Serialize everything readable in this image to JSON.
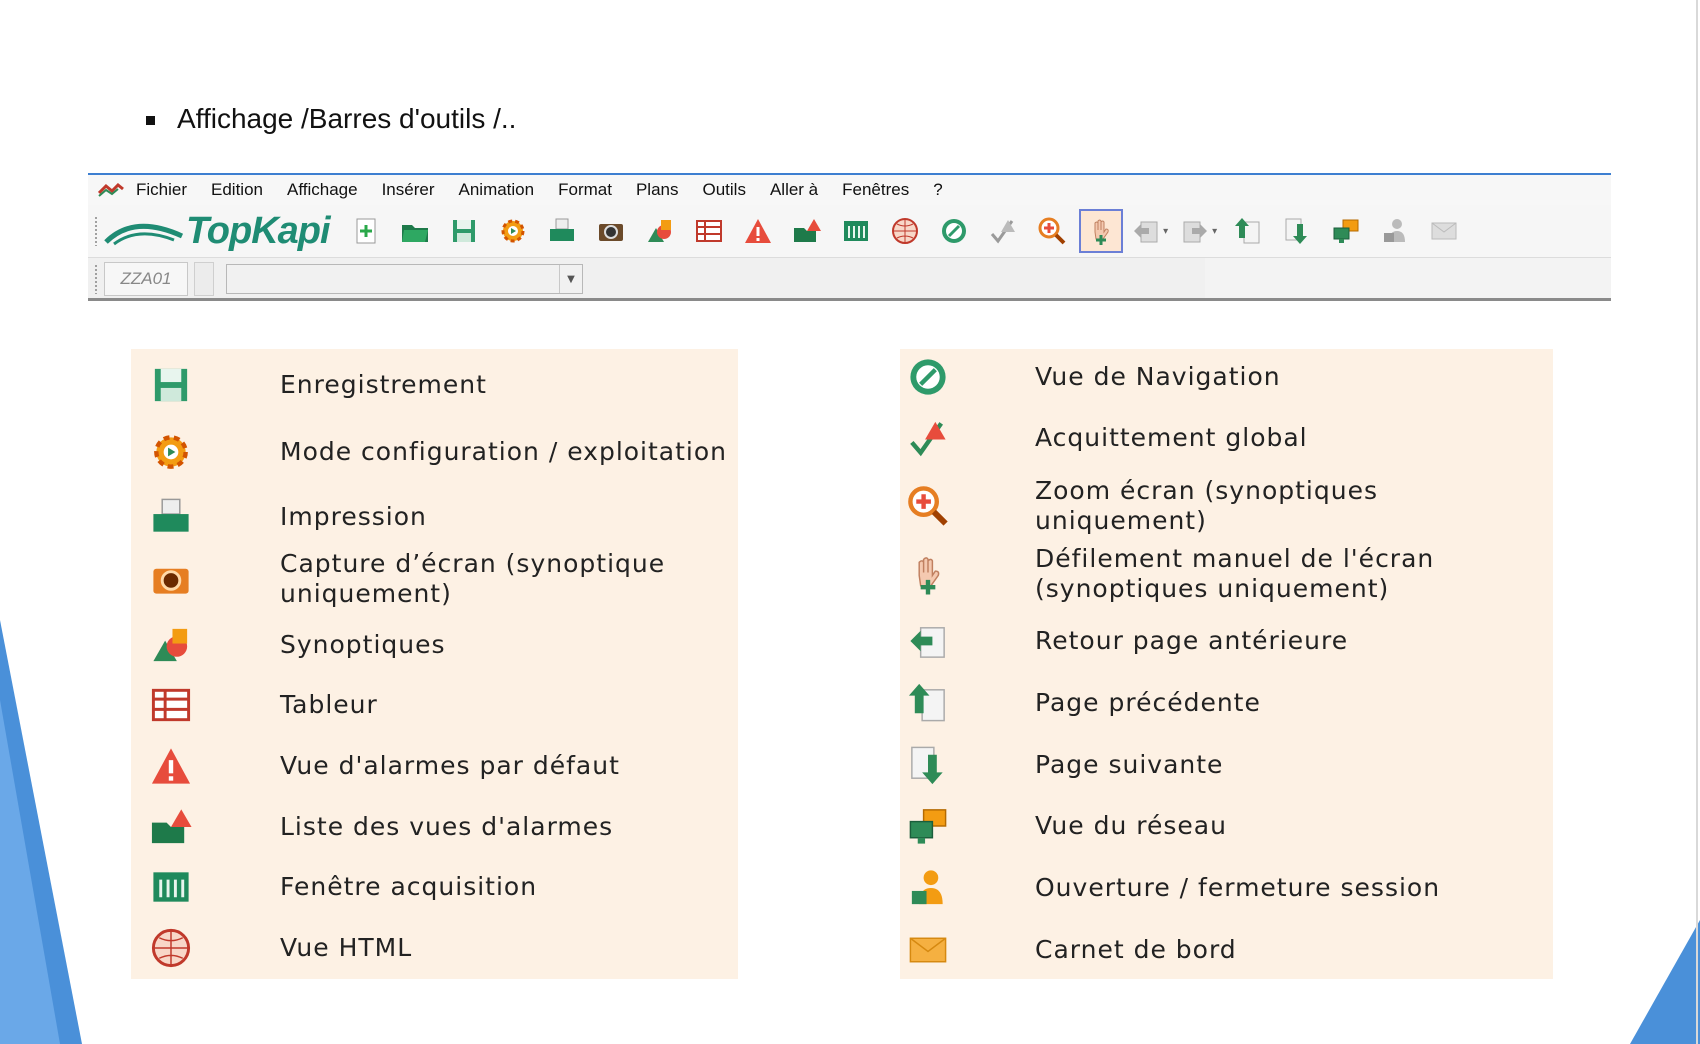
{
  "slide": {
    "bullet_text": "Affichage /Barres d'outils /.."
  },
  "menu": {
    "items": [
      "Fichier",
      "Edition",
      "Affichage",
      "Insérer",
      "Animation",
      "Format",
      "Plans",
      "Outils",
      "Aller à",
      "Fenêtres",
      "?"
    ]
  },
  "toolbar": {
    "logo_text": "TopKapi",
    "brand_color": "#1f8c74",
    "buttons": [
      "new-icon",
      "open-folder-icon",
      "save-icon",
      "config-mode-icon",
      "print-icon",
      "camera-icon",
      "synoptic-icon",
      "table-icon",
      "alarm-icon",
      "alarm-list-icon",
      "acquisition-icon",
      "html-globe-icon",
      "navigation-icon",
      "acknowledge-icon",
      "zoom-icon",
      "hand-scroll-icon",
      "back-icon",
      "forward-icon",
      "page-previous-icon",
      "page-next-icon",
      "network-icon",
      "session-icon",
      "mail-icon"
    ]
  },
  "toolbar2": {
    "station": "ZZA01",
    "combo_value": ""
  },
  "legend_left": [
    {
      "icon": "save-icon",
      "label": "Enregistrement"
    },
    {
      "icon": "config-mode-icon",
      "label": "Mode configuration / exploitation"
    },
    {
      "icon": "print-icon",
      "label": "Impression"
    },
    {
      "icon": "camera-icon",
      "label": "Capture d’écran (synoptique uniquement)"
    },
    {
      "icon": "synoptic-icon",
      "label": "Synoptiques"
    },
    {
      "icon": "table-icon",
      "label": "Tableur"
    },
    {
      "icon": "alarm-icon",
      "label": "Vue d'alarmes par défaut"
    },
    {
      "icon": "alarm-list-icon",
      "label": "Liste des vues d'alarmes"
    },
    {
      "icon": "acquisition-icon",
      "label": "Fenêtre acquisition"
    },
    {
      "icon": "html-globe-icon",
      "label": "Vue HTML"
    }
  ],
  "legend_right": [
    {
      "icon": "navigation-icon",
      "label": "Vue de Navigation"
    },
    {
      "icon": "acknowledge-icon",
      "label": "Acquittement global"
    },
    {
      "icon": "zoom-icon",
      "label": "Zoom écran (synoptiques uniquement)"
    },
    {
      "icon": "hand-scroll-icon",
      "label": "Défilement manuel de l'écran (synoptiques uniquement)"
    },
    {
      "icon": "back-icon",
      "label": "Retour page antérieure"
    },
    {
      "icon": "page-previous-icon",
      "label": "Page précédente"
    },
    {
      "icon": "page-next-icon",
      "label": "Page suivante"
    },
    {
      "icon": "network-icon",
      "label": "Vue du réseau"
    },
    {
      "icon": "session-icon",
      "label": "Ouverture / fermeture session"
    },
    {
      "icon": "mail-icon",
      "label": "Carnet de bord"
    }
  ]
}
